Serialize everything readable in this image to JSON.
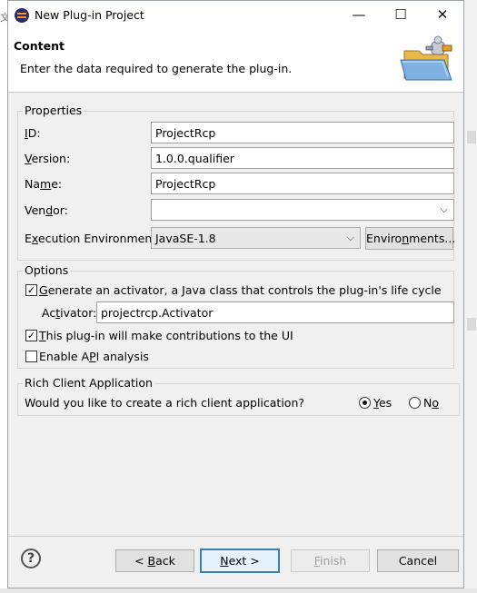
{
  "background": {
    "glyph": "文"
  },
  "window": {
    "title": "New Plug-in Project",
    "minimize": "—",
    "maximize": "☐",
    "close": "✕"
  },
  "header": {
    "title": "Content",
    "description": "Enter the data required to generate the plug-in."
  },
  "properties": {
    "group_label": "Properties",
    "id": {
      "label_u": "I",
      "label_rest": "D:",
      "value": "ProjectRcp"
    },
    "version": {
      "label_u": "V",
      "label_rest": "ersion:",
      "value": "1.0.0.qualifier"
    },
    "name": {
      "label_pre": "Na",
      "label_u": "m",
      "label_rest": "e:",
      "value": "ProjectRcp"
    },
    "vendor": {
      "label_pre": "Ven",
      "label_u": "d",
      "label_rest": "or:",
      "value": ""
    },
    "exec_env": {
      "label_pre": "E",
      "label_u": "x",
      "label_rest": "ecution Environment:",
      "value": "JavaSE-1.8",
      "button_pre": "Enviro",
      "button_u": "n",
      "button_rest": "ments..."
    }
  },
  "options": {
    "group_label": "Options",
    "generate_activator": {
      "pre": "",
      "u": "G",
      "rest": "enerate an activator, a Java class that controls the plug-in's life cycle",
      "checked": true
    },
    "activator": {
      "label_pre": "Ac",
      "label_u": "t",
      "label_rest": "ivator:",
      "value": "projectrcp.Activator"
    },
    "ui_contrib": {
      "pre": "",
      "u": "T",
      "rest": "his plug-in will make contributions to the UI",
      "checked": true
    },
    "api_analysis": {
      "pre": "Enable A",
      "u": "P",
      "rest": "I analysis",
      "checked": false
    }
  },
  "rcp": {
    "group_label": "Rich Client Application",
    "question": "Would you like to create a rich client application?",
    "yes": {
      "u": "Y",
      "rest": "es",
      "selected": true
    },
    "no": {
      "pre": "N",
      "u": "o",
      "rest": "",
      "selected": false
    }
  },
  "buttons": {
    "help": "?",
    "back": {
      "pre": "< ",
      "u": "B",
      "rest": "ack"
    },
    "next": {
      "pre": "",
      "u": "N",
      "rest": "ext >"
    },
    "finish": {
      "pre": "",
      "u": "F",
      "rest": "inish"
    },
    "cancel": "Cancel"
  },
  "check_glyph": "✓",
  "combo_arrow": "⌵"
}
